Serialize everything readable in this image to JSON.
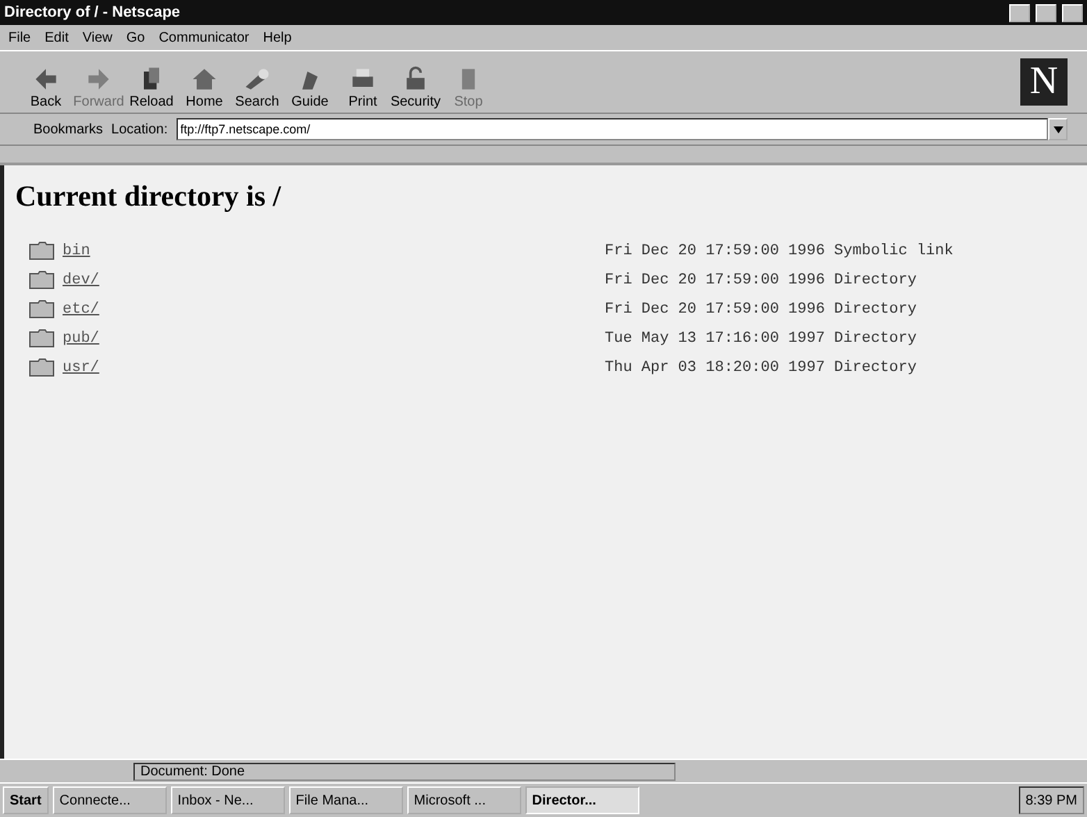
{
  "window": {
    "title": "Directory of / - Netscape"
  },
  "menu": [
    "File",
    "Edit",
    "View",
    "Go",
    "Communicator",
    "Help"
  ],
  "toolbar": [
    {
      "label": "Back",
      "disabled": false
    },
    {
      "label": "Forward",
      "disabled": true
    },
    {
      "label": "Reload",
      "disabled": false
    },
    {
      "label": "Home",
      "disabled": false
    },
    {
      "label": "Search",
      "disabled": false
    },
    {
      "label": "Guide",
      "disabled": false
    },
    {
      "label": "Print",
      "disabled": false
    },
    {
      "label": "Security",
      "disabled": false
    },
    {
      "label": "Stop",
      "disabled": true
    }
  ],
  "logo": "N",
  "location_bar": {
    "bookmarks": "Bookmarks",
    "label": "Location:",
    "value": "ftp://ftp7.netscape.com/"
  },
  "page": {
    "heading": "Current directory is /",
    "entries": [
      {
        "name": "bin",
        "date": "Fri Dec 20 17:59:00 1996",
        "type": "Symbolic link"
      },
      {
        "name": "dev/",
        "date": "Fri Dec 20 17:59:00 1996",
        "type": "Directory"
      },
      {
        "name": "etc/",
        "date": "Fri Dec 20 17:59:00 1996",
        "type": "Directory"
      },
      {
        "name": "pub/",
        "date": "Tue May 13 17:16:00 1997",
        "type": "Directory"
      },
      {
        "name": "usr/",
        "date": "Thu Apr 03 18:20:00 1997",
        "type": "Directory"
      }
    ]
  },
  "status_bar": {
    "text": "Document: Done"
  },
  "taskbar": {
    "start": "Start",
    "tasks": [
      {
        "label": "Connecte...",
        "selected": false
      },
      {
        "label": "Inbox - Ne...",
        "selected": false
      },
      {
        "label": "File Mana...",
        "selected": false
      },
      {
        "label": "Microsoft ...",
        "selected": false
      },
      {
        "label": "Director...",
        "selected": true
      }
    ],
    "clock": "8:39 PM"
  }
}
